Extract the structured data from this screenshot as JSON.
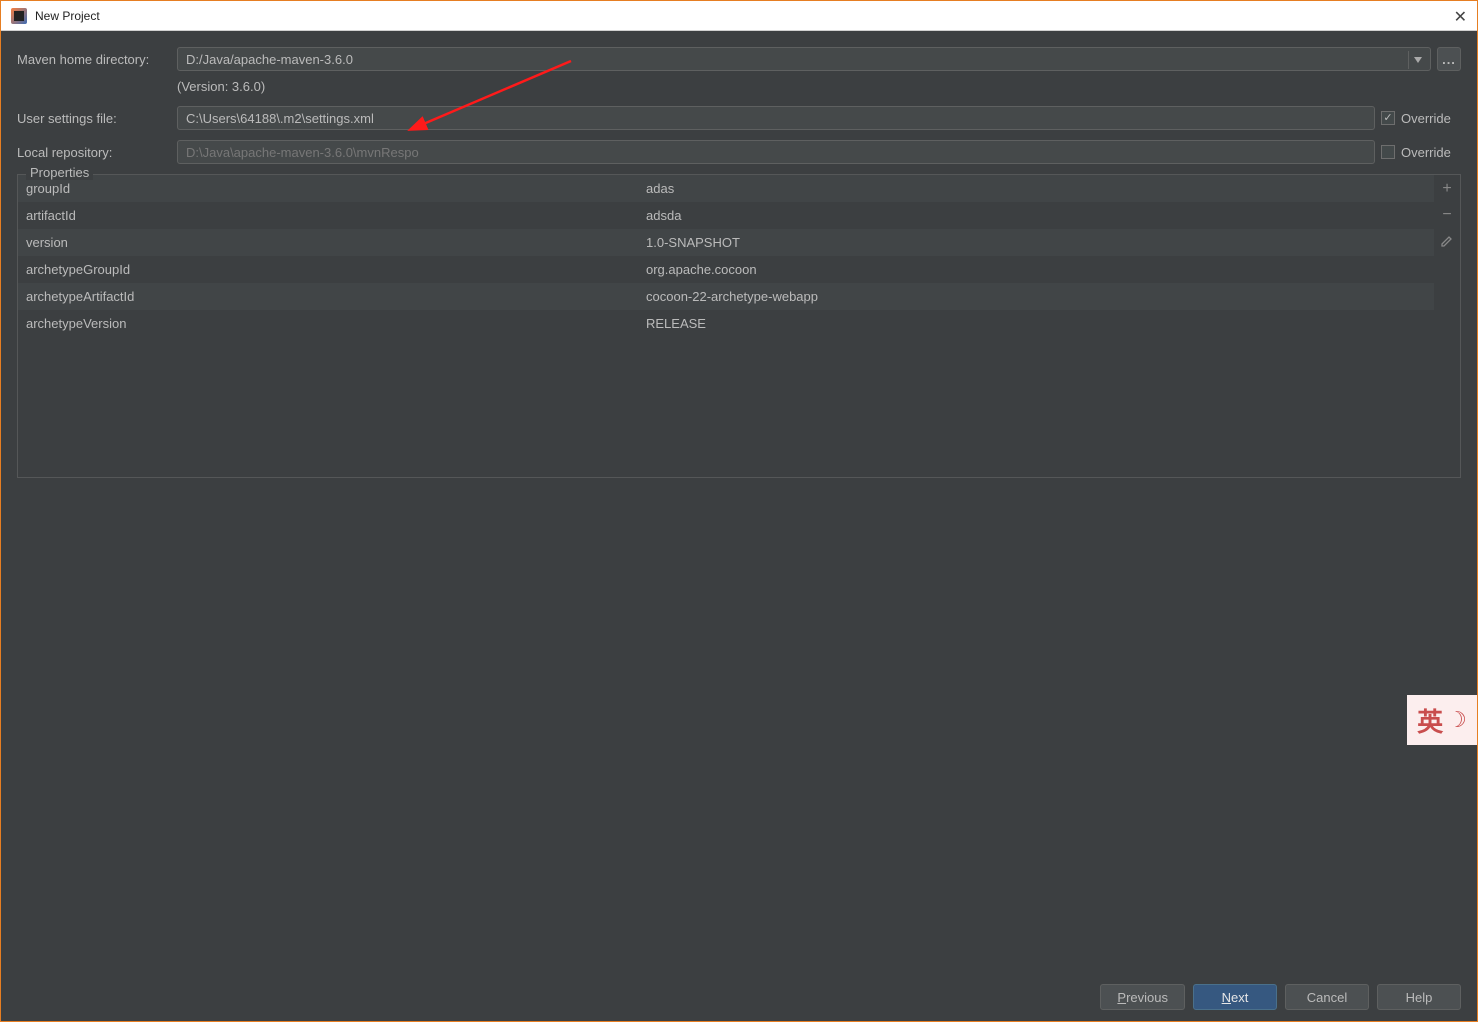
{
  "window": {
    "title": "New Project"
  },
  "labels": {
    "maven_home": "Maven home directory:",
    "user_settings": "User settings file:",
    "local_repo": "Local repository:",
    "override": "Override",
    "properties": "Properties",
    "version_note": "(Version: 3.6.0)"
  },
  "fields": {
    "maven_home": "D:/Java/apache-maven-3.6.0",
    "user_settings": "C:\\Users\\64188\\.m2\\settings.xml",
    "local_repo": "D:\\Java\\apache-maven-3.6.0\\mvnRespo"
  },
  "overrides": {
    "user_settings_checked": true,
    "local_repo_checked": false
  },
  "properties": [
    {
      "key": "groupId",
      "value": "adas"
    },
    {
      "key": "artifactId",
      "value": "adsda"
    },
    {
      "key": "version",
      "value": "1.0-SNAPSHOT"
    },
    {
      "key": "archetypeGroupId",
      "value": "org.apache.cocoon"
    },
    {
      "key": "archetypeArtifactId",
      "value": "cocoon-22-archetype-webapp"
    },
    {
      "key": "archetypeVersion",
      "value": "RELEASE"
    }
  ],
  "buttons": {
    "previous": "Previous",
    "next": "Next",
    "cancel": "Cancel",
    "help": "Help"
  },
  "ime": {
    "char": "英"
  }
}
